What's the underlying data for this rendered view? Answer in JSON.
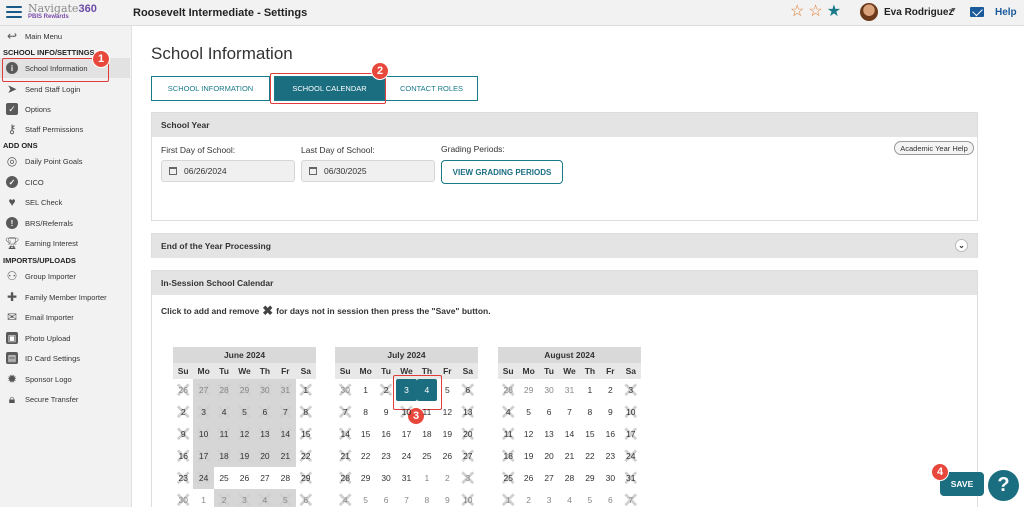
{
  "app": {
    "logo_prefix": "Navigate",
    "logo_suffix": "360",
    "logo_subtitle": "PBIS Rewards",
    "title": "Roosevelt Intermediate - Settings"
  },
  "user": {
    "name": "Eva Rodriguez"
  },
  "header": {
    "help_label": "Help"
  },
  "sidebar": {
    "main_menu": "Main Menu",
    "sections": [
      {
        "header": "SCHOOL INFO/SETTINGS",
        "items": [
          "School Information",
          "Send Staff Login",
          "Options",
          "Staff Permissions"
        ]
      },
      {
        "header": "ADD ONS",
        "items": [
          "Daily Point Goals",
          "CICO",
          "SEL Check",
          "BRS/Referrals",
          "Earning Interest"
        ]
      },
      {
        "header": "IMPORTS/UPLOADS",
        "items": [
          "Group Importer",
          "Family Member Importer",
          "Email Importer",
          "Photo Upload",
          "ID Card Settings",
          "Sponsor Logo",
          "Secure Transfer"
        ]
      }
    ]
  },
  "page": {
    "title": "School Information"
  },
  "tabs": [
    "SCHOOL INFORMATION",
    "SCHOOL CALENDAR",
    "CONTACT ROLES"
  ],
  "school_year": {
    "heading": "School Year",
    "first_day_label": "First Day of School:",
    "first_day_value": "06/26/2024",
    "last_day_label": "Last Day of School:",
    "last_day_value": "06/30/2025",
    "grading_label": "Grading Periods:",
    "grading_button": "VIEW GRADING PERIODS",
    "help_button": "Academic Year Help"
  },
  "end_of_year": {
    "heading": "End of the Year Processing"
  },
  "calendar_section": {
    "heading": "In-Session School Calendar",
    "instructions_before": "Click to add and remove",
    "instructions_after": "for days not in session then press the \"Save\" button."
  },
  "weekdays": [
    "Su",
    "Mo",
    "Tu",
    "We",
    "Th",
    "Fr",
    "Sa"
  ],
  "calendars": [
    {
      "title": "June 2024",
      "rows": [
        [
          "26",
          "27",
          "28",
          "29",
          "30",
          "31",
          "1"
        ],
        [
          "2",
          "3",
          "4",
          "5",
          "6",
          "7",
          "8"
        ],
        [
          "9",
          "10",
          "11",
          "12",
          "13",
          "14",
          "15"
        ],
        [
          "16",
          "17",
          "18",
          "19",
          "20",
          "21",
          "22"
        ],
        [
          "23",
          "24",
          "25",
          "26",
          "27",
          "28",
          "29"
        ],
        [
          "30",
          "1",
          "2",
          "3",
          "4",
          "5",
          "6"
        ]
      ]
    },
    {
      "title": "July 2024",
      "rows": [
        [
          "30",
          "1",
          "2",
          "3",
          "4",
          "5",
          "6"
        ],
        [
          "7",
          "8",
          "9",
          "10",
          "11",
          "12",
          "13"
        ],
        [
          "14",
          "15",
          "16",
          "17",
          "18",
          "19",
          "20"
        ],
        [
          "21",
          "22",
          "23",
          "24",
          "25",
          "26",
          "27"
        ],
        [
          "28",
          "29",
          "30",
          "31",
          "1",
          "2",
          "3"
        ],
        [
          "4",
          "5",
          "6",
          "7",
          "8",
          "9",
          "10"
        ]
      ]
    },
    {
      "title": "August 2024",
      "rows": [
        [
          "28",
          "29",
          "30",
          "31",
          "1",
          "2",
          "3"
        ],
        [
          "4",
          "5",
          "6",
          "7",
          "8",
          "9",
          "10"
        ],
        [
          "11",
          "12",
          "13",
          "14",
          "15",
          "16",
          "17"
        ],
        [
          "18",
          "19",
          "20",
          "21",
          "22",
          "23",
          "24"
        ],
        [
          "25",
          "26",
          "27",
          "28",
          "29",
          "30",
          "31"
        ],
        [
          "1",
          "2",
          "3",
          "4",
          "5",
          "6",
          "7"
        ]
      ]
    }
  ],
  "actions": {
    "save_label": "SAVE",
    "help_bubble": "?"
  },
  "callouts": [
    "1",
    "2",
    "3",
    "4"
  ],
  "colors": {
    "primary": "#1a6e80",
    "callout": "#e8483c",
    "star_outline": "#e07a2e"
  }
}
